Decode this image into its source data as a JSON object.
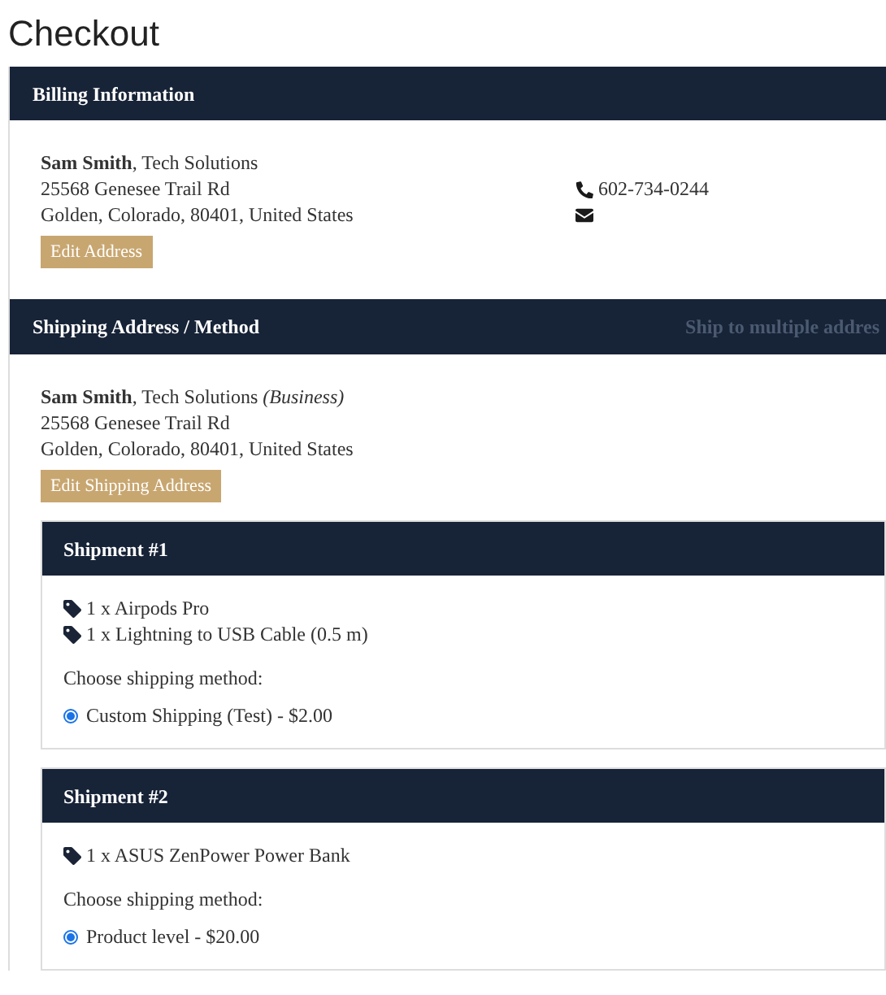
{
  "page_title": "Checkout",
  "billing": {
    "title": "Billing Information",
    "name_line": "**Sam Smith**, Tech Solutions",
    "address_lines": [
      "25568 Genesee Trail Rd",
      "Golden, Colorado, 80401, United States"
    ],
    "phone": "602-734-0244",
    "edit_button": "Edit Address"
  },
  "shipping": {
    "title": "Shipping Address / Method",
    "multiple_link": "Ship to multiple addres",
    "name_line": "**Sam Smith**, Tech Solutions *(Business)*",
    "address_lines": [
      "25568 Genesee Trail Rd",
      "Golden, Colorado, 80401, United States"
    ],
    "edit_button": "Edit Shipping Address",
    "shipments": [
      {
        "title": "Shipment #1",
        "items": [
          "1 x Airpods Pro",
          "1 x Lightning to USB Cable (0.5 m)"
        ],
        "method_label": "Choose shipping method:",
        "methods": [
          {
            "label": "Custom Shipping (Test) - $2.00",
            "selected": true
          }
        ]
      },
      {
        "title": "Shipment #2",
        "items": [
          "1 x ASUS ZenPower Power Bank"
        ],
        "method_label": "Choose shipping method:",
        "methods": [
          {
            "label": "Product level - $20.00",
            "selected": true
          }
        ]
      }
    ]
  }
}
